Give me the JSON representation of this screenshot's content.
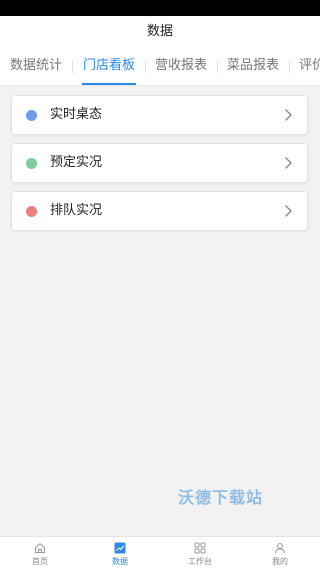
{
  "header": {
    "title": "数据"
  },
  "tabs": [
    {
      "label": "数据统计",
      "active": false
    },
    {
      "label": "门店看板",
      "active": true
    },
    {
      "label": "营收报表",
      "active": false
    },
    {
      "label": "菜品报表",
      "active": false
    },
    {
      "label": "评价",
      "active": false
    }
  ],
  "cards": [
    {
      "label": "实时桌态",
      "dot_color": "#6f9ee8",
      "icon": "chevron-right-icon"
    },
    {
      "label": "预定实况",
      "dot_color": "#7ccd9b",
      "icon": "chevron-right-icon"
    },
    {
      "label": "排队实况",
      "dot_color": "#ee7f7a",
      "icon": "chevron-right-icon"
    }
  ],
  "watermark": "沃德下载站",
  "bottom_nav": [
    {
      "label": "首页",
      "icon": "home-icon",
      "active": false
    },
    {
      "label": "数据",
      "icon": "chart-icon",
      "active": true
    },
    {
      "label": "工作台",
      "icon": "grid-icon",
      "active": false
    },
    {
      "label": "我的",
      "icon": "user-icon",
      "active": false
    }
  ],
  "colors": {
    "accent": "#2e88e6"
  }
}
